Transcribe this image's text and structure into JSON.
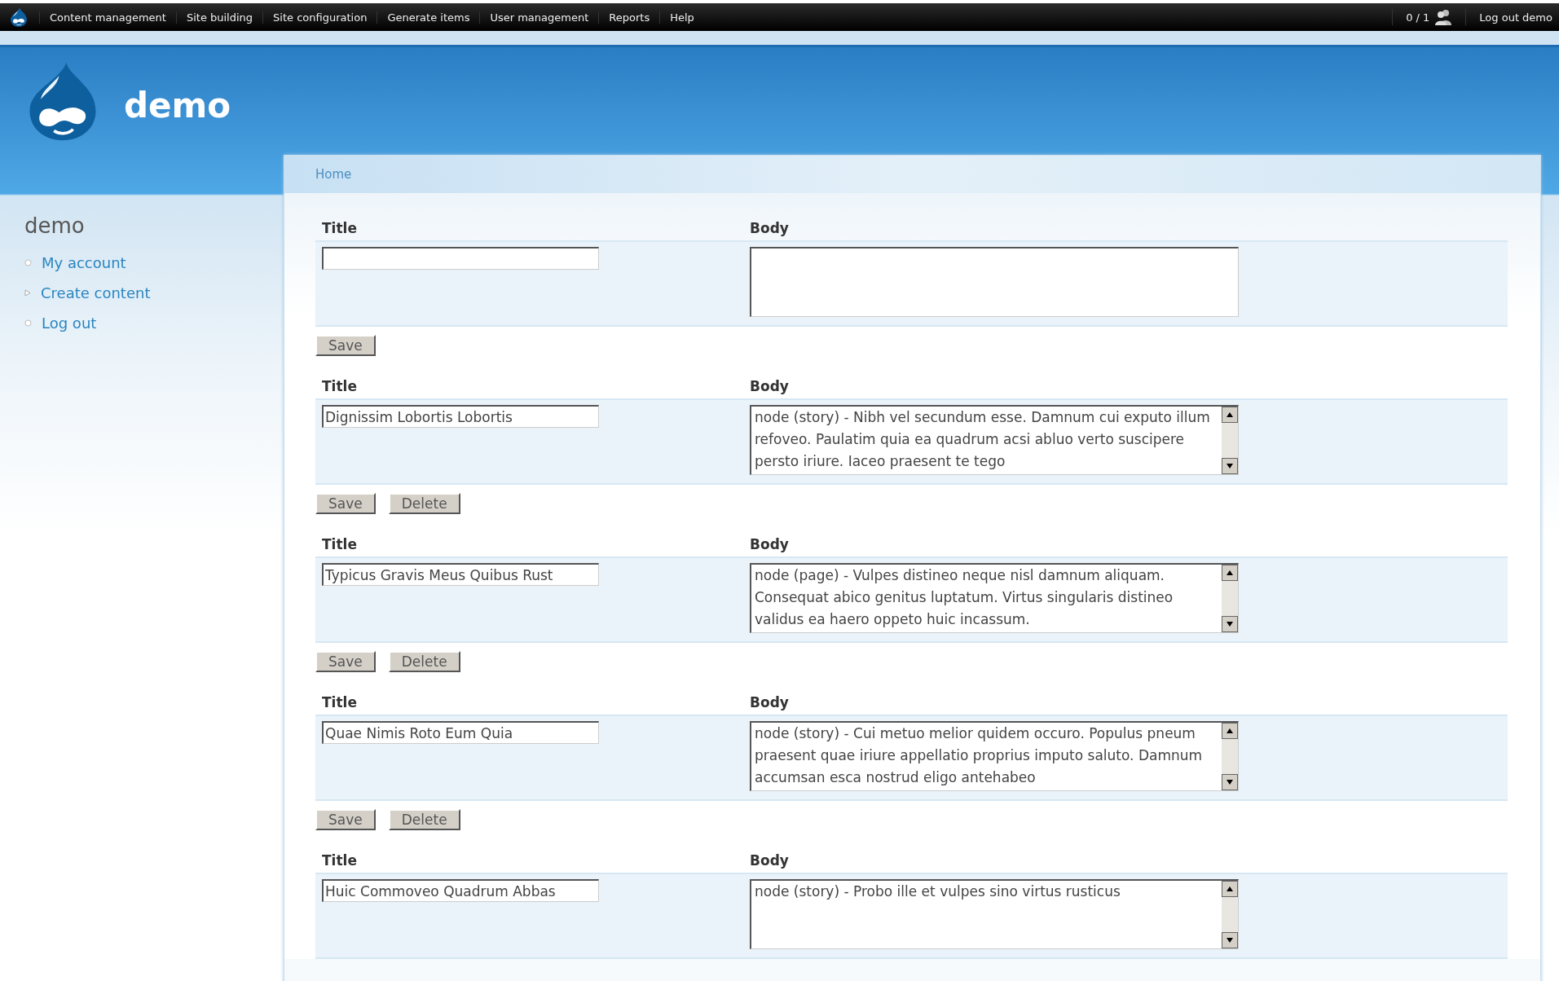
{
  "toolbar": {
    "menu": [
      "Content management",
      "Site building",
      "Site configuration",
      "Generate items",
      "User management",
      "Reports",
      "Help"
    ],
    "users_online": "0 / 1",
    "logout": "Log out demo"
  },
  "header": {
    "site_name": "demo"
  },
  "breadcrumb": [
    "Home"
  ],
  "sidebar": {
    "title": "demo",
    "items": [
      {
        "label": "My account",
        "kind": "leaf"
      },
      {
        "label": "Create content",
        "kind": "collapsed"
      },
      {
        "label": "Log out",
        "kind": "leaf"
      }
    ]
  },
  "forms": [
    {
      "title_label": "Title",
      "body_label": "Body",
      "buttons": [
        "Save"
      ]
    },
    {
      "title_label": "Title",
      "body_label": "Body",
      "title_value": "Dignissim Lobortis Lobortis",
      "body_value": "node (story) - Nibh vel secundum esse. Damnum cui exputo illum refoveo. Paulatim quia ea quadrum acsi abluo verto suscipere persto iriure. Iaceo praesent te tego",
      "buttons": [
        "Save",
        "Delete"
      ]
    },
    {
      "title_label": "Title",
      "body_label": "Body",
      "title_value": "Typicus Gravis Meus Quibus Rust",
      "body_value": "node (page) - Vulpes distineo neque nisl damnum aliquam. Consequat abico genitus luptatum. Virtus singularis distineo validus ea haero oppeto huic incassum.",
      "buttons": [
        "Save",
        "Delete"
      ]
    },
    {
      "title_label": "Title",
      "body_label": "Body",
      "title_value": "Quae Nimis Roto Eum Quia",
      "body_value": "node (story) - Cui metuo melior quidem occuro. Populus pneum praesent quae iriure appellatio proprius imputo saluto. Damnum accumsan esca nostrud eligo antehabeo",
      "buttons": [
        "Save",
        "Delete"
      ]
    },
    {
      "title_label": "Title",
      "body_label": "Body",
      "title_value": "Huic Commoveo Quadrum Abbas",
      "body_value": "node (story) - Probo ille et vulpes sino virtus rusticus"
    }
  ]
}
